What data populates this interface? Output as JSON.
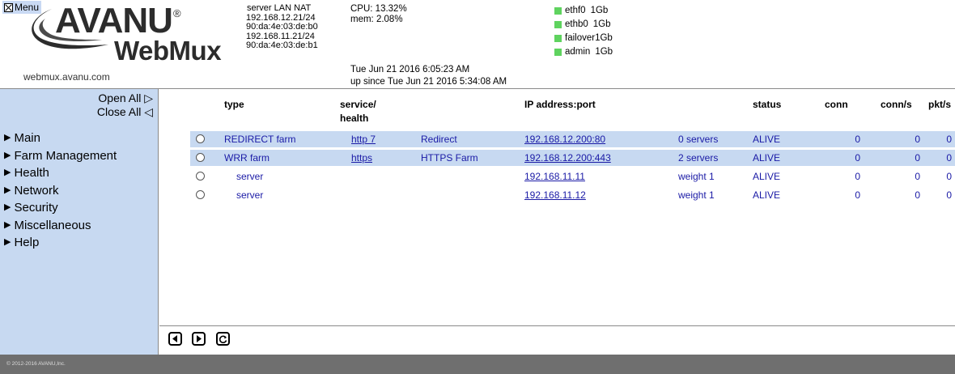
{
  "header": {
    "menu_label": "Menu",
    "logo": {
      "brand": "AVANU",
      "reg_mark": "®",
      "product": "WebMux"
    },
    "site_url": "webmux.avanu.com",
    "server": {
      "title": "server LAN NAT",
      "lines": [
        "192.168.12.21/24",
        "90:da:4e:03:de:b0",
        "192.168.11.21/24",
        "90:da:4e:03:de:b1"
      ]
    },
    "system": {
      "cpu": "CPU: 13.32%",
      "mem": "mem: 2.08%",
      "datetime": "Tue Jun 21 2016 6:05:23 AM",
      "uptime": "up since Tue Jun 21 2016 5:34:08 AM"
    },
    "interfaces": [
      {
        "name": "ethf0",
        "speed": "1Gb",
        "status_color": "#5fd35f"
      },
      {
        "name": "ethb0",
        "speed": "1Gb",
        "status_color": "#5fd35f"
      },
      {
        "name": "failover",
        "speed": "1Gb",
        "status_color": "#5fd35f"
      },
      {
        "name": "admin",
        "speed": "1Gb",
        "status_color": "#5fd35f"
      }
    ]
  },
  "sidebar": {
    "open_all": "Open All ▷",
    "close_all": "Close All ◁",
    "items": [
      {
        "label": "Main"
      },
      {
        "label": "Farm Management"
      },
      {
        "label": "Health"
      },
      {
        "label": "Network"
      },
      {
        "label": "Security"
      },
      {
        "label": "Miscellaneous"
      },
      {
        "label": "Help"
      }
    ]
  },
  "table": {
    "headers": {
      "type": "type",
      "service": "service/",
      "health": "health",
      "ip": "IP address:port",
      "status": "status",
      "conn": "conn",
      "conn_s": "conn/s",
      "pkt_s": "pkt/s"
    },
    "rows": [
      {
        "kind": "farm",
        "type": "REDIRECT farm",
        "service": "http 7",
        "desc": "Redirect",
        "ip": "192.168.12.200:80",
        "info": "0 servers",
        "status": "ALIVE",
        "conn": "0",
        "conn_s": "0",
        "pkt_s": "0"
      },
      {
        "kind": "farm",
        "type": "WRR farm",
        "service": "https",
        "desc": "HTTPS Farm",
        "ip": "192.168.12.200:443",
        "info": "2 servers",
        "status": "ALIVE",
        "conn": "0",
        "conn_s": "0",
        "pkt_s": "0"
      },
      {
        "kind": "server",
        "type": "server",
        "service": "",
        "desc": "",
        "ip": "192.168.11.11",
        "info": "weight 1",
        "status": "ALIVE",
        "conn": "0",
        "conn_s": "0",
        "pkt_s": "0"
      },
      {
        "kind": "server",
        "type": "server",
        "service": "",
        "desc": "",
        "ip": "192.168.11.12",
        "info": "weight 1",
        "status": "ALIVE",
        "conn": "0",
        "conn_s": "0",
        "pkt_s": "0"
      }
    ]
  },
  "controls": {
    "prev_icon": "triangle-left-icon",
    "next_icon": "triangle-right-icon",
    "refresh_icon": "refresh-icon"
  },
  "footer": {
    "copyright": "© 2012-2016 AVANU,Inc."
  },
  "colors": {
    "highlight": "#c7d9f1",
    "footer": "#6f6f6f",
    "link": "#1a1aa6",
    "led": "#5fd35f"
  }
}
